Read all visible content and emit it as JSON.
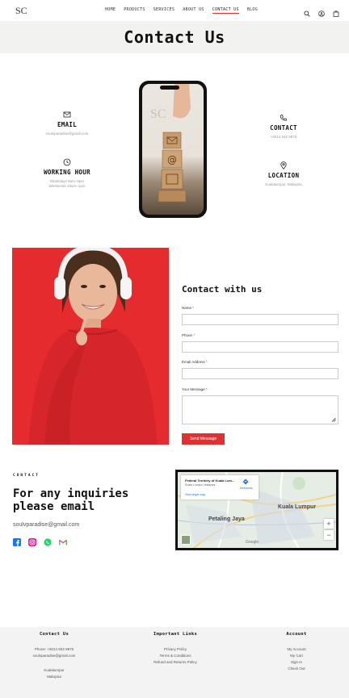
{
  "header": {
    "logo_text": "SC",
    "nav": [
      "HOME",
      "PRODUCTS",
      "SERVICES",
      "ABOUT US",
      "CONTACT US",
      "BLOG"
    ],
    "active_nav": "CONTACT US",
    "icons": [
      "search-icon",
      "user-icon",
      "cart-icon"
    ]
  },
  "page_title": "Contact Us",
  "info": {
    "email": {
      "label": "EMAIL",
      "value": "soulvparadise@gmail.com",
      "icon": "envelope-icon"
    },
    "hours": {
      "label": "WORKING HOUR",
      "line1": "Weekdays 9am–5pm",
      "line2": "Weekends 10am–1pm",
      "icon": "clock-icon"
    },
    "contact": {
      "label": "CONTACT",
      "value": "+6014 932 9875",
      "icon": "phone-icon"
    },
    "location": {
      "label": "LOCATION",
      "value": "Kualalumpur, Malaysia",
      "icon": "location-pin-icon"
    }
  },
  "phone_logo": "SC",
  "form": {
    "title": "Contact with us",
    "name_label": "Name",
    "phone_label": "Phone",
    "email_label": "Email Address",
    "message_label": "Your Message",
    "required_mark": "*",
    "submit_label": "Send Message"
  },
  "inquiries": {
    "kicker": "CONTACT",
    "title": "For any inquiries please email",
    "email": "soulvparadise@gmail.com",
    "socials": [
      "facebook-icon",
      "instagram-icon",
      "whatsapp-icon",
      "gmail-icon"
    ]
  },
  "map": {
    "card_title": "Federal Territory of Kuala Lum...",
    "card_sub": "Kuala Lumpur, Malaysia",
    "card_link": "View larger map",
    "directions": "Directions",
    "labels": [
      "Kuala Lumpur",
      "Petaling Jaya"
    ],
    "zoom_in": "+",
    "zoom_out": "−",
    "google": "Google"
  },
  "footer": {
    "col1": {
      "title": "Contact Us",
      "phone": "Phone: +6014 932 9875",
      "email": "soulvparadise@gmail.com",
      "city": "Kualalumpur",
      "country": "Malaysia"
    },
    "col2": {
      "title": "Important Links",
      "links": [
        "Privacy Policy",
        "Terms & Conditions",
        "Refund and Returns Policy"
      ]
    },
    "col3": {
      "title": "Account",
      "links": [
        "My Account",
        "My Cart",
        "Sign In",
        "Check Out"
      ]
    }
  },
  "colors": {
    "accent": "#e0302f",
    "photo_bg": "#e52b2e",
    "title_band": "#f2f2f0",
    "footer_bg": "#f3f3f3"
  }
}
